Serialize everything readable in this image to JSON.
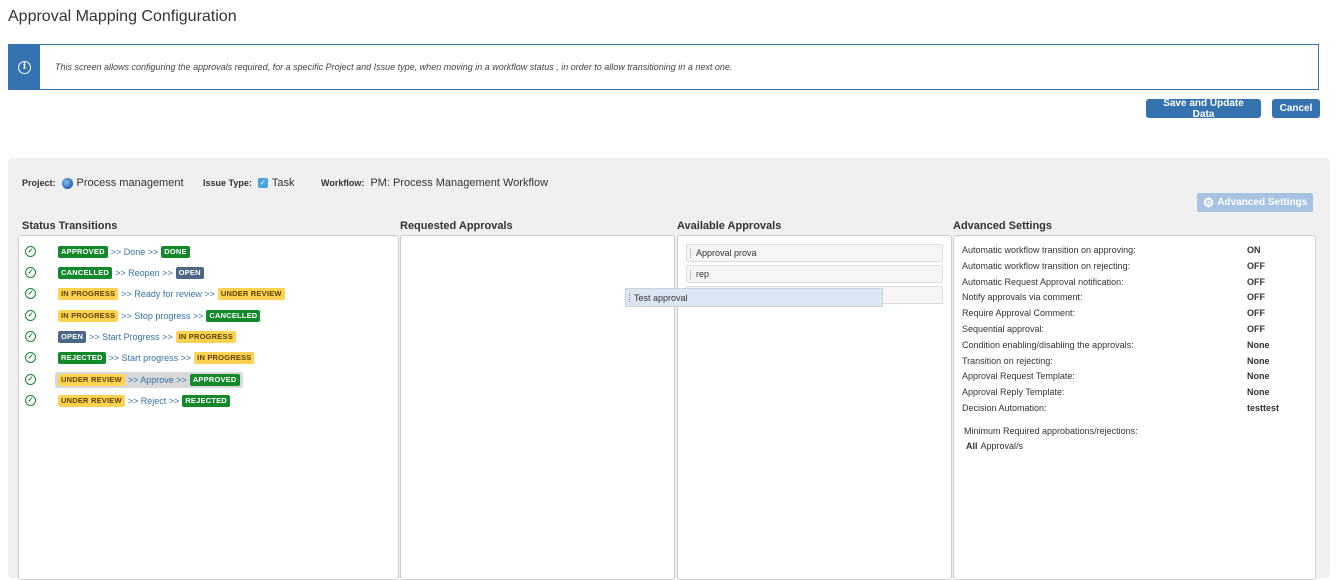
{
  "page": {
    "title": "Approval Mapping Configuration",
    "info": "This screen allows configuring the approvals required, for a specific Project and Issue type, when moving in a workflow status , in order to allow transitioning in a next one."
  },
  "buttons": {
    "save": "Save and Update Data",
    "cancel": "Cancel",
    "advanced": "Advanced Settings"
  },
  "meta": {
    "project_label": "Project:",
    "project": "Process management",
    "issue_type_label": "Issue Type:",
    "issue_type": "Task",
    "workflow_label": "Workflow:",
    "workflow": "PM: Process Management Workflow"
  },
  "columns": {
    "status_transitions": "Status Transitions",
    "requested_approvals": "Requested Approvals",
    "available_approvals": "Available Approvals",
    "advanced_settings": "Advanced Settings"
  },
  "transitions": [
    {
      "from": "APPROVED",
      "from_color": "green",
      "action": ">> Done >>",
      "to": "DONE",
      "to_color": "green",
      "selected": false
    },
    {
      "from": "CANCELLED",
      "from_color": "green",
      "action": ">> Reopen >>",
      "to": "OPEN",
      "to_color": "blue",
      "selected": false
    },
    {
      "from": "IN PROGRESS",
      "from_color": "yellow",
      "action": ">> Ready for review >>",
      "to": "UNDER REVIEW",
      "to_color": "yellow",
      "selected": false
    },
    {
      "from": "IN PROGRESS",
      "from_color": "yellow",
      "action": ">> Stop progress >>",
      "to": "CANCELLED",
      "to_color": "green",
      "selected": false
    },
    {
      "from": "OPEN",
      "from_color": "blue",
      "action": ">> Start Progress >>",
      "to": "IN PROGRESS",
      "to_color": "yellow",
      "selected": false
    },
    {
      "from": "REJECTED",
      "from_color": "green",
      "action": ">> Start progress >>",
      "to": "IN PROGRESS",
      "to_color": "yellow",
      "selected": false
    },
    {
      "from": "UNDER REVIEW",
      "from_color": "yellow",
      "action": ">> Approve >>",
      "to": "APPROVED",
      "to_color": "green",
      "selected": true
    },
    {
      "from": "UNDER REVIEW",
      "from_color": "yellow",
      "action": ">> Reject >>",
      "to": "REJECTED",
      "to_color": "green",
      "selected": false
    }
  ],
  "available_approvals": [
    "Approval prova",
    "rep",
    ""
  ],
  "dragging_approval": "Test approval",
  "advanced_settings": [
    {
      "name": "Automatic workflow transition on approving:",
      "value": "ON"
    },
    {
      "name": "Automatic workflow transition on rejecting:",
      "value": "OFF"
    },
    {
      "name": "Automatic Request Approval notification:",
      "value": "OFF"
    },
    {
      "name": "Notify approvals via comment:",
      "value": "OFF"
    },
    {
      "name": "Require Approval Comment:",
      "value": "OFF"
    },
    {
      "name": "Sequential approval:",
      "value": "OFF"
    },
    {
      "name": "Condition enabling/disabling the approvals:",
      "value": "None"
    },
    {
      "name": "Transition on rejecting:",
      "value": "None"
    },
    {
      "name": "Approval Request Template:",
      "value": "None"
    },
    {
      "name": "Approval Reply Template:",
      "value": "None"
    },
    {
      "name": "Decision Automation:",
      "value": "testtest"
    }
  ],
  "minimum": {
    "label": "Minimum Required approbations/rejections:",
    "value_bold": "All",
    "value_rest": "Approval/s"
  },
  "colors": {
    "primary": "#3572b0",
    "status_green": "#14892c",
    "status_blue": "#4a6785",
    "status_yellow": "#ffd351"
  }
}
